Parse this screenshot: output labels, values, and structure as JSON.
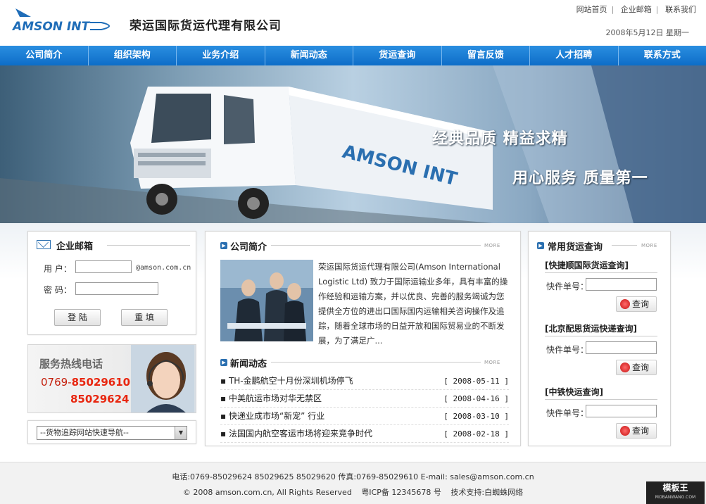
{
  "header": {
    "logo_text": "AMSON INT",
    "company_name": "荣运国际货运代理有限公司",
    "top_links": [
      "网站首页",
      "企业邮箱",
      "联系我们"
    ],
    "date": "2008年5月12日 星期一"
  },
  "nav": {
    "items": [
      "公司简介",
      "组织架构",
      "业务介绍",
      "新闻动态",
      "货运查询",
      "留言反馈",
      "人才招聘",
      "联系方式"
    ]
  },
  "banner": {
    "slogan1": "经典品质  精益求精",
    "slogan2": "用心服务  质量第一",
    "truck_text": "AMSON INT"
  },
  "mail": {
    "title": "企业邮箱",
    "user_label": "用  户：",
    "domain": "@amson.com.cn",
    "password_label": "密  码：",
    "login_label": "登 陆",
    "reset_label": "重 填"
  },
  "hotline": {
    "title": "服务热线电话",
    "prefix": "0769-",
    "number1": "85029610",
    "number2": "85029624"
  },
  "tracker": {
    "selected": "--货物追踪网站快速导航--"
  },
  "intro": {
    "title": "公司简介",
    "more": "MORE",
    "text": "荣运国际货运代理有限公司(Amson International Logistic Ltd) 致力于国际运输业多年，具有丰富的操作经验和运输方案，并以优良、完善的服务竭诚为您提供全方位的进出口国际国内运输相关咨询操作及追踪，随着全球市场的日益开放和国际贸易业的不断发展，为了满足广..."
  },
  "news": {
    "title": "新闻动态",
    "more": "MORE",
    "items": [
      {
        "title": "TH-金鹏航空十月份深圳机场停飞",
        "date": "[ 2008-05-11 ]"
      },
      {
        "title": "中美航运市场对华无禁区",
        "date": "[ 2008-04-16 ]"
      },
      {
        "title": "快递业成市场“新宠” 行业",
        "date": "[ 2008-03-10 ]"
      },
      {
        "title": "法国国内航空客运市场将迎来竞争时代",
        "date": "[ 2008-02-18 ]"
      }
    ]
  },
  "query": {
    "title": "常用货运查询",
    "more": "MORE",
    "sections": [
      {
        "head": "[快捷顺国际货运查询]",
        "label": "快件单号：",
        "button": "查询"
      },
      {
        "head": "[北京配思货运快递查询]",
        "label": "快件单号：",
        "button": "查询"
      },
      {
        "head": "[中铁快运查询]",
        "label": "快件单号：",
        "button": "查询"
      }
    ]
  },
  "footer": {
    "contact": "电话:0769-85029624   85029625   85029620   传真:0769-85029610   E-mail: sales@amson.com.cn",
    "copyright": "© 2008 amson.com.cn, All Rights Reserved",
    "icp": "粤ICP备 12345678 号",
    "support": "技术支持:白蜘蛛网络",
    "watermark": "模板王",
    "watermark_url": "MOBANWANG.COM"
  }
}
